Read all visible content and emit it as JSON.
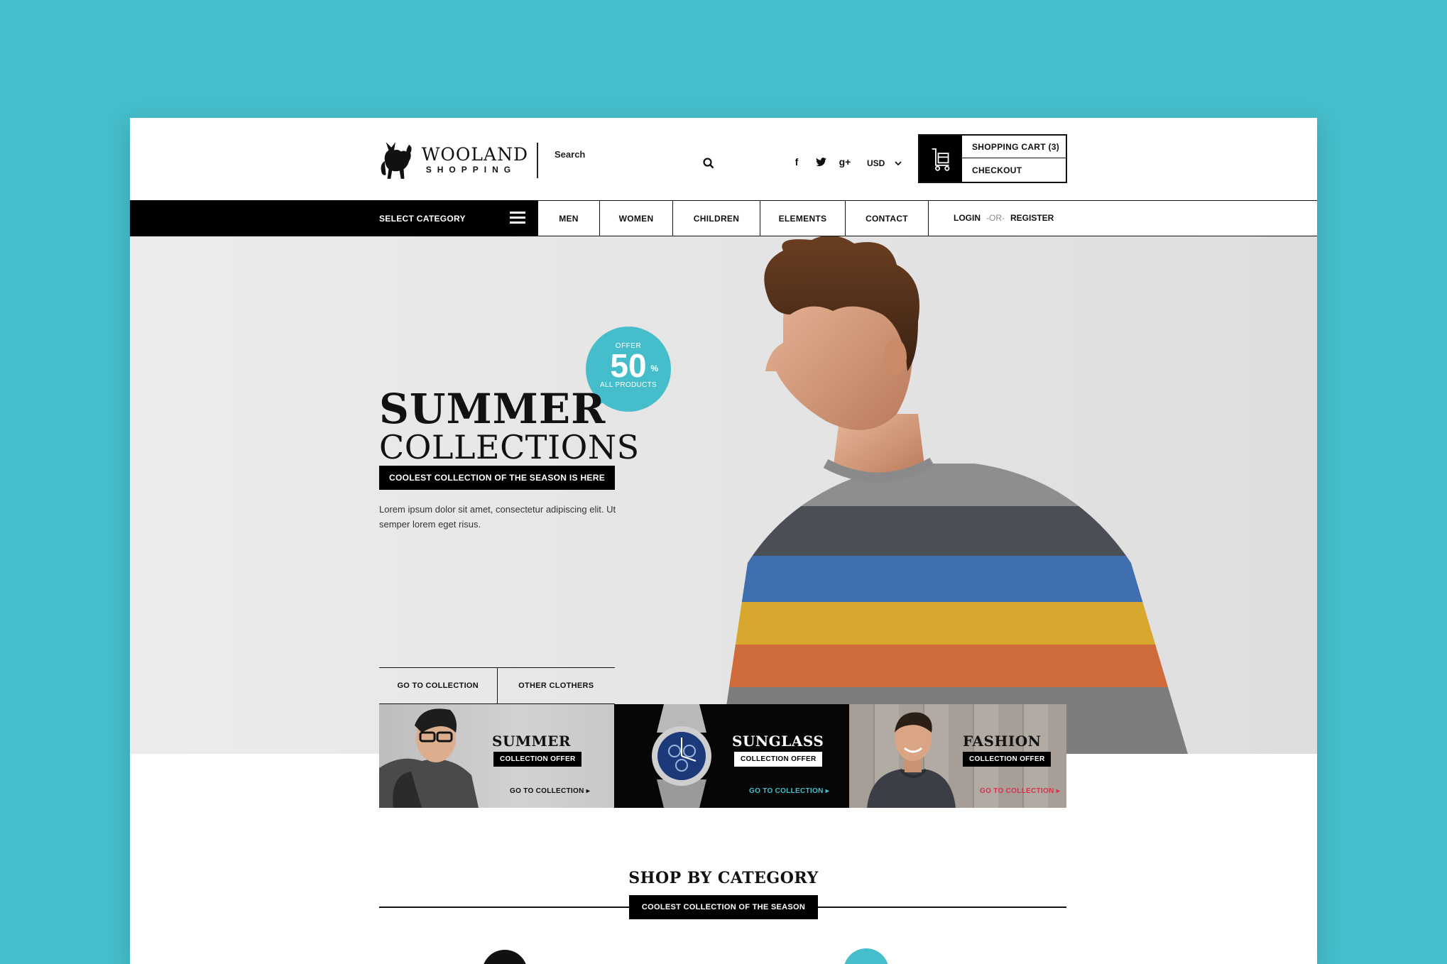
{
  "colors": {
    "background": "#45bdca",
    "accent": "#45bdca",
    "dark": "#000000",
    "link_red": "#d6324a"
  },
  "brand": {
    "name": "WOOLAND",
    "sub": "SHOPPING",
    "logo_icon": "cat-logo-icon"
  },
  "header": {
    "search_label": "Search",
    "search_icon": "search-icon",
    "socials": [
      {
        "icon": "facebook-icon",
        "glyph": "f"
      },
      {
        "icon": "twitter-icon",
        "glyph": "t"
      },
      {
        "icon": "google-plus-icon",
        "glyph": "g+"
      }
    ],
    "currency": "USD",
    "cart_label": "SHOPPING CART (3)",
    "checkout_label": "CHECKOUT",
    "cart_icon": "shopping-cart-icon"
  },
  "nav": {
    "category_label": "SELECT CATEGORY",
    "items": [
      "MEN",
      "WOMEN",
      "CHILDREN",
      "ELEMENTS",
      "CONTACT"
    ],
    "login": "LOGIN",
    "or": "-OR-",
    "register": "REGISTER"
  },
  "hero": {
    "offer_top": "OFFER",
    "offer_value": "50",
    "offer_unit": "%",
    "offer_bottom": "ALL PRODUCTS",
    "title_line1": "SUMMER",
    "title_line2": "COLLECTIONS",
    "tagline": "COOLEST COLLECTION OF THE SEASON IS HERE",
    "description": "Lorem ipsum dolor sit amet, consectetur adipiscing elit. Ut semper lorem eget risus.",
    "button_primary": "GO TO COLLECTION",
    "button_secondary": "OTHER CLOTHERS"
  },
  "tiles": [
    {
      "title": "SUMMER",
      "badge": "COLLECTION OFFER",
      "link": "GO TO COLLECTION"
    },
    {
      "title": "SUNGLASS",
      "badge": "COLLECTION OFFER",
      "link": "GO TO COLLECTION"
    },
    {
      "title": "FASHION",
      "badge": "COLLECTION OFFER",
      "link": "GO TO COLLECTION"
    }
  ],
  "shop_by_category": {
    "title": "SHOP BY CATEGORY",
    "tagline": "COOLEST COLLECTION OF THE SEASON"
  }
}
